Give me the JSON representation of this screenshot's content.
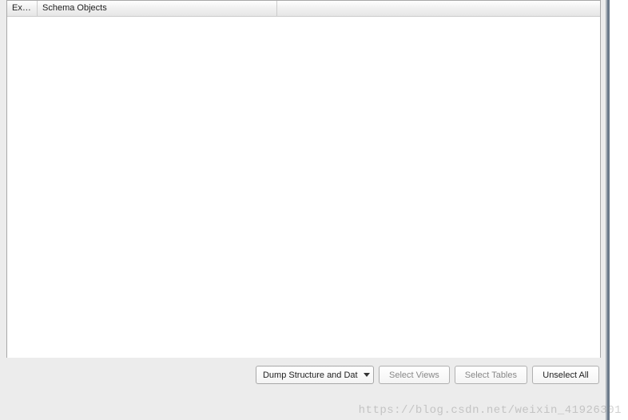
{
  "table": {
    "columns": {
      "exp": "Exp...",
      "schema_objects": "Schema Objects"
    }
  },
  "controls": {
    "dump_dropdown": {
      "selected": "Dump Structure and Dat"
    },
    "select_views": "Select Views",
    "select_tables": "Select Tables",
    "unselect_all": "Unselect All"
  },
  "watermark": "https://blog.csdn.net/weixin_41926301"
}
